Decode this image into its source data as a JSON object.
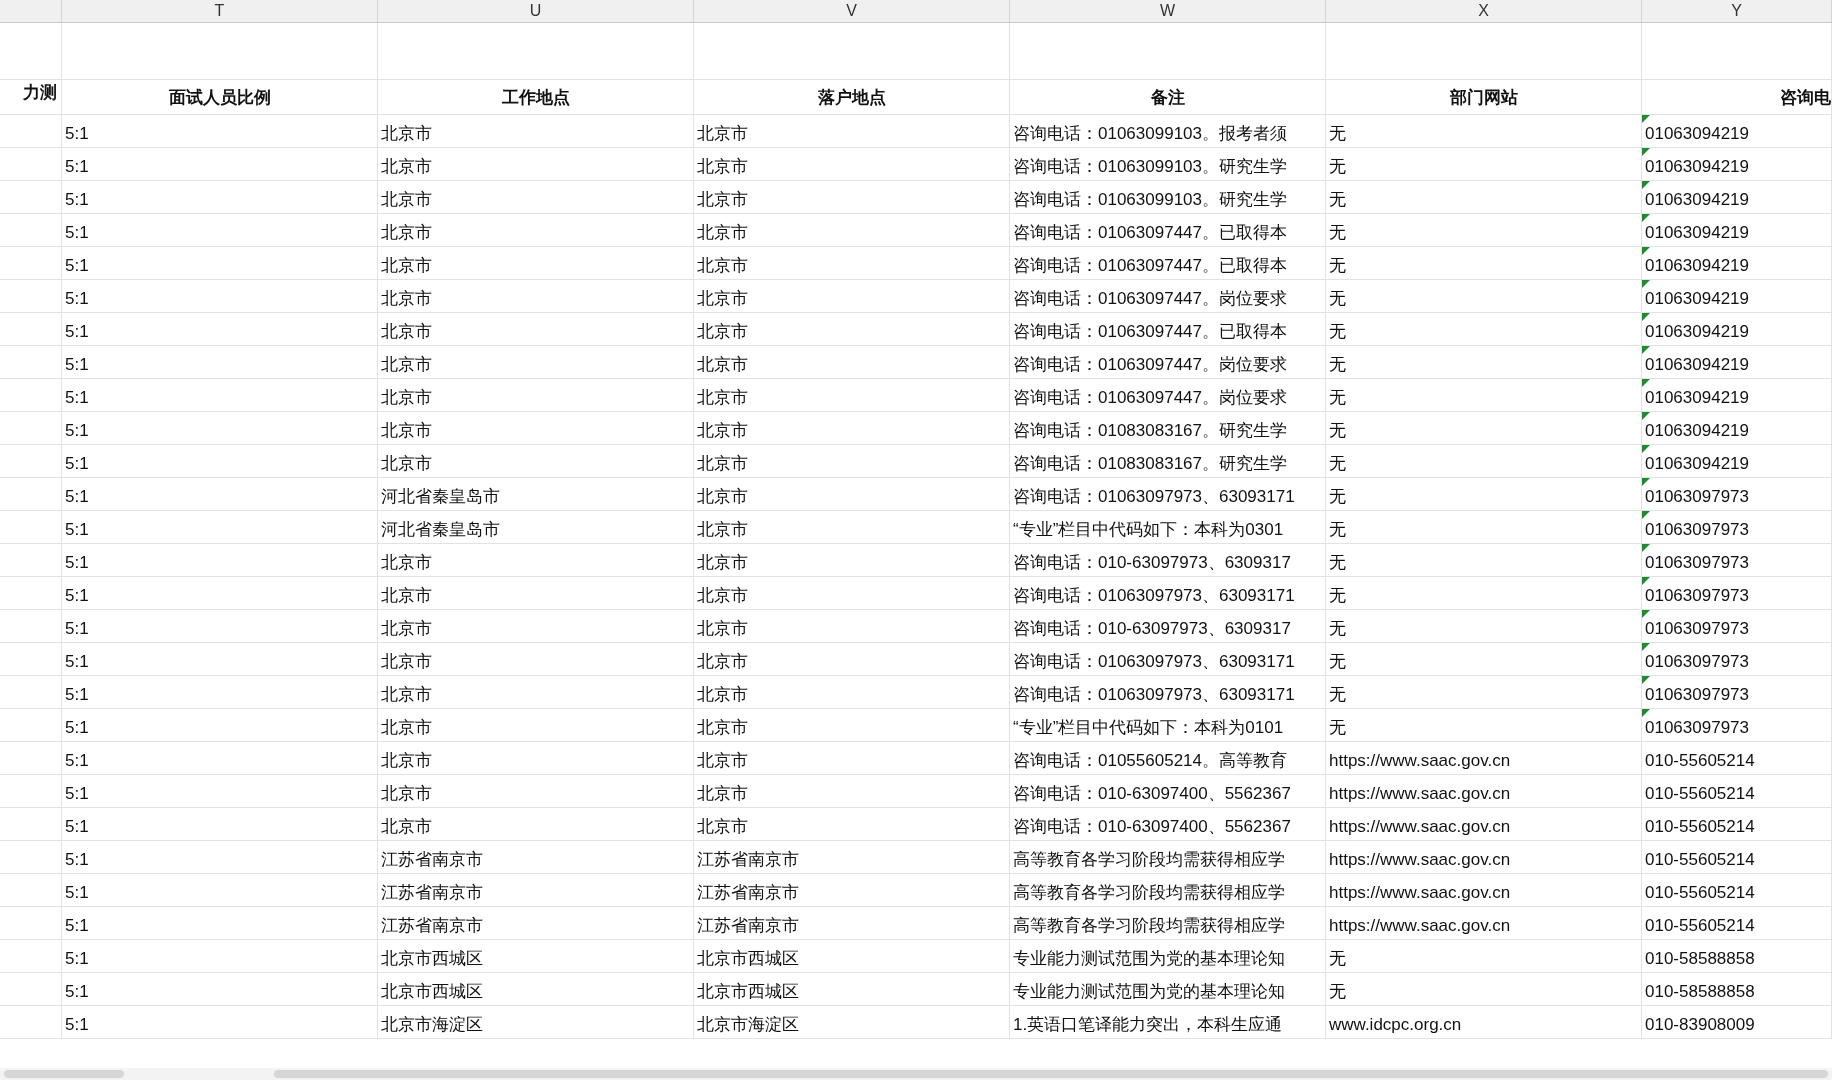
{
  "columns": [
    {
      "header": "力测"
    },
    {
      "letter": "T",
      "header": "面试人员比例"
    },
    {
      "letter": "U",
      "header": "工作地点"
    },
    {
      "letter": "V",
      "header": "落户地点"
    },
    {
      "letter": "W",
      "header": "备注"
    },
    {
      "letter": "X",
      "header": "部门网站"
    },
    {
      "letter": "Y",
      "header": "咨询电"
    }
  ],
  "rows": [
    {
      "ratio": "5:1",
      "work": "北京市",
      "hukou": "北京市",
      "note": "咨询电话：01063099103。报考者须",
      "site": "无",
      "phone": "01063094219",
      "flagged": true
    },
    {
      "ratio": "5:1",
      "work": "北京市",
      "hukou": "北京市",
      "note": "咨询电话：01063099103。研究生学",
      "site": "无",
      "phone": "01063094219",
      "flagged": true
    },
    {
      "ratio": "5:1",
      "work": "北京市",
      "hukou": "北京市",
      "note": "咨询电话：01063099103。研究生学",
      "site": "无",
      "phone": "01063094219",
      "flagged": true
    },
    {
      "ratio": "5:1",
      "work": "北京市",
      "hukou": "北京市",
      "note": "咨询电话：01063097447。已取得本",
      "site": "无",
      "phone": "01063094219",
      "flagged": true
    },
    {
      "ratio": "5:1",
      "work": "北京市",
      "hukou": "北京市",
      "note": "咨询电话：01063097447。已取得本",
      "site": "无",
      "phone": "01063094219",
      "flagged": true
    },
    {
      "ratio": "5:1",
      "work": "北京市",
      "hukou": "北京市",
      "note": "咨询电话：01063097447。岗位要求",
      "site": "无",
      "phone": "01063094219",
      "flagged": true
    },
    {
      "ratio": "5:1",
      "work": "北京市",
      "hukou": "北京市",
      "note": "咨询电话：01063097447。已取得本",
      "site": "无",
      "phone": "01063094219",
      "flagged": true
    },
    {
      "ratio": "5:1",
      "work": "北京市",
      "hukou": "北京市",
      "note": "咨询电话：01063097447。岗位要求",
      "site": "无",
      "phone": "01063094219",
      "flagged": true
    },
    {
      "ratio": "5:1",
      "work": "北京市",
      "hukou": "北京市",
      "note": "咨询电话：01063097447。岗位要求",
      "site": "无",
      "phone": "01063094219",
      "flagged": true
    },
    {
      "ratio": "5:1",
      "work": "北京市",
      "hukou": "北京市",
      "note": "咨询电话：01083083167。研究生学",
      "site": "无",
      "phone": "01063094219",
      "flagged": true
    },
    {
      "ratio": "5:1",
      "work": "北京市",
      "hukou": "北京市",
      "note": "咨询电话：01083083167。研究生学",
      "site": "无",
      "phone": "01063094219",
      "flagged": true
    },
    {
      "ratio": "5:1",
      "work": "河北省秦皇岛市",
      "hukou": "北京市",
      "note": "咨询电话：01063097973、63093171",
      "site": "无",
      "phone": "01063097973",
      "flagged": true
    },
    {
      "ratio": "5:1",
      "work": "河北省秦皇岛市",
      "hukou": "北京市",
      "note": "“专业”栏目中代码如下：本科为0301",
      "site": "无",
      "phone": "01063097973",
      "flagged": true
    },
    {
      "ratio": "5:1",
      "work": "北京市",
      "hukou": "北京市",
      "note": "咨询电话：010-63097973、6309317",
      "site": "无",
      "phone": "01063097973",
      "flagged": true
    },
    {
      "ratio": "5:1",
      "work": "北京市",
      "hukou": "北京市",
      "note": "咨询电话：01063097973、63093171",
      "site": "无",
      "phone": "01063097973",
      "flagged": true
    },
    {
      "ratio": "5:1",
      "work": "北京市",
      "hukou": "北京市",
      "note": "咨询电话：010-63097973、6309317",
      "site": "无",
      "phone": "01063097973",
      "flagged": true
    },
    {
      "ratio": "5:1",
      "work": "北京市",
      "hukou": "北京市",
      "note": "咨询电话：01063097973、63093171",
      "site": "无",
      "phone": "01063097973",
      "flagged": true
    },
    {
      "ratio": "5:1",
      "work": "北京市",
      "hukou": "北京市",
      "note": "咨询电话：01063097973、63093171",
      "site": "无",
      "phone": "01063097973",
      "flagged": true
    },
    {
      "ratio": "5:1",
      "work": "北京市",
      "hukou": "北京市",
      "note": "“专业”栏目中代码如下：本科为0101",
      "site": "无",
      "phone": "01063097973",
      "flagged": true
    },
    {
      "ratio": "5:1",
      "work": "北京市",
      "hukou": "北京市",
      "note": "咨询电话：01055605214。高等教育",
      "site": "https://www.saac.gov.cn",
      "phone": "010-55605214",
      "flagged": false
    },
    {
      "ratio": "5:1",
      "work": "北京市",
      "hukou": "北京市",
      "note": "咨询电话：010-63097400、5562367",
      "site": "https://www.saac.gov.cn",
      "phone": "010-55605214",
      "flagged": false
    },
    {
      "ratio": "5:1",
      "work": "北京市",
      "hukou": "北京市",
      "note": "咨询电话：010-63097400、5562367",
      "site": "https://www.saac.gov.cn",
      "phone": "010-55605214",
      "flagged": false
    },
    {
      "ratio": "5:1",
      "work": "江苏省南京市",
      "hukou": "江苏省南京市",
      "note": "高等教育各学习阶段均需获得相应学",
      "site": "https://www.saac.gov.cn",
      "phone": "010-55605214",
      "flagged": false
    },
    {
      "ratio": "5:1",
      "work": "江苏省南京市",
      "hukou": "江苏省南京市",
      "note": "高等教育各学习阶段均需获得相应学",
      "site": "https://www.saac.gov.cn",
      "phone": "010-55605214",
      "flagged": false
    },
    {
      "ratio": "5:1",
      "work": "江苏省南京市",
      "hukou": "江苏省南京市",
      "note": "高等教育各学习阶段均需获得相应学",
      "site": "https://www.saac.gov.cn",
      "phone": "010-55605214",
      "flagged": false
    },
    {
      "ratio": "5:1",
      "work": "北京市西城区",
      "hukou": "北京市西城区",
      "note": "专业能力测试范围为党的基本理论知",
      "site": "无",
      "phone": "010-58588858",
      "flagged": false
    },
    {
      "ratio": "5:1",
      "work": "北京市西城区",
      "hukou": "北京市西城区",
      "note": "专业能力测试范围为党的基本理论知",
      "site": "无",
      "phone": "010-58588858",
      "flagged": false
    },
    {
      "ratio": "5:1",
      "work": "北京市海淀区",
      "hukou": "北京市海淀区",
      "note": "1.英语口笔译能力突出，本科生应通",
      "site": "www.idcpc.org.cn",
      "phone": "010-83908009",
      "flagged": false
    }
  ]
}
